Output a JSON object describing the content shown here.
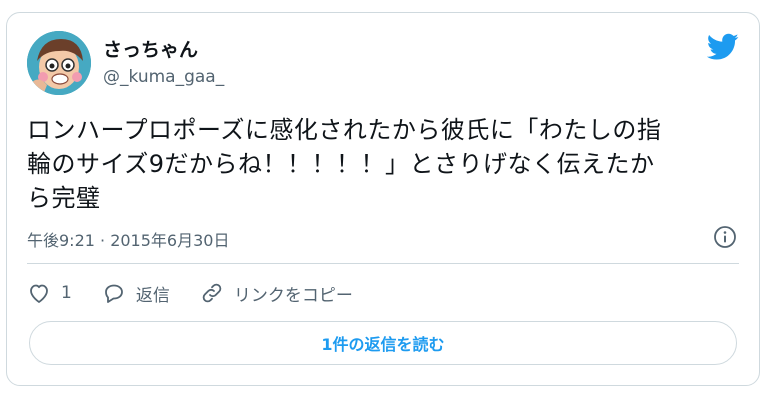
{
  "user": {
    "display_name": "さっちゃん",
    "handle": "@_kuma_gaa_"
  },
  "tweet": {
    "text": "ロンハープロポーズに感化されたから彼氏に「わたしの指\n輪のサイズ9だからね！！！！！」とさりげなく伝えたか\nら完璧",
    "timestamp": "午後9:21 · 2015年6月30日"
  },
  "actions": {
    "like_count": "1",
    "reply_label": "返信",
    "copy_link_label": "リンクをコピー"
  },
  "read_replies_label": "1件の返信を読む",
  "icons": {
    "brand": "twitter-bird-icon",
    "info": "info-icon",
    "like": "heart-icon",
    "reply": "speech-bubble-icon",
    "link": "link-icon"
  },
  "colors": {
    "twitter_blue": "#1d9bf0",
    "secondary_text": "#536471",
    "border": "#cfd9de"
  }
}
